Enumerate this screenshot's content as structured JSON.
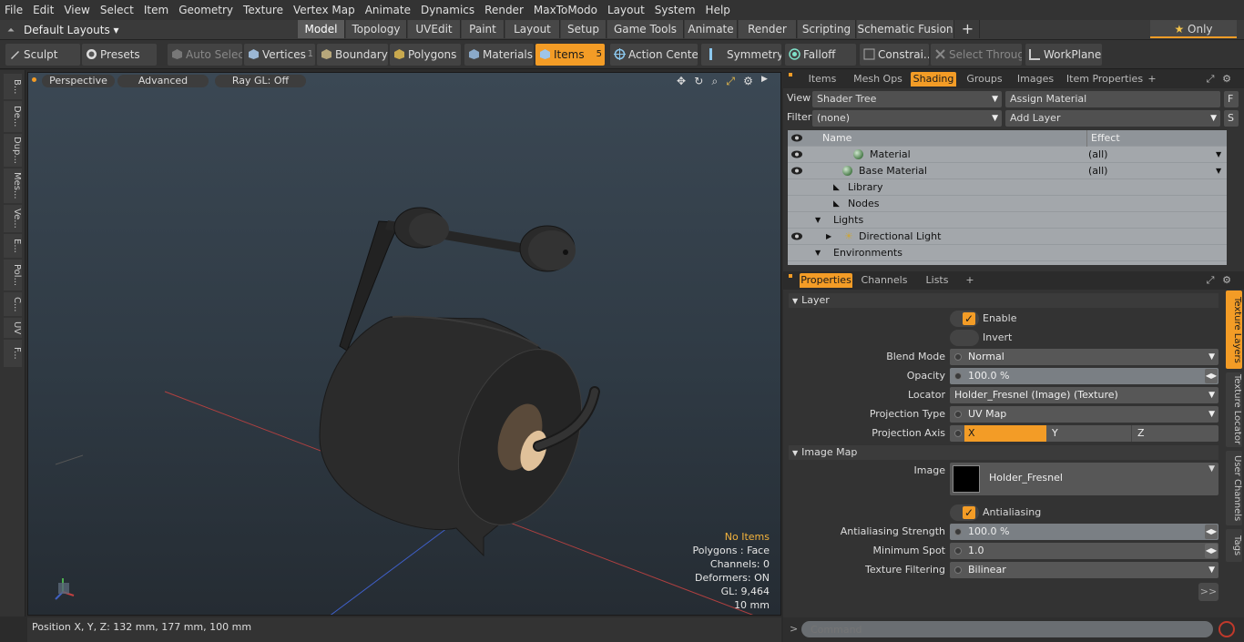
{
  "menu": [
    "File",
    "Edit",
    "View",
    "Select",
    "Item",
    "Geometry",
    "Texture",
    "Vertex Map",
    "Animate",
    "Dynamics",
    "Render",
    "MaxToModo",
    "Layout",
    "System",
    "Help"
  ],
  "layouts_label": "Default Layouts ▾",
  "modes": [
    "Model",
    "Topology",
    "UVEdit",
    "Paint",
    "Layout",
    "Setup",
    "Game Tools",
    "Animate",
    "Render",
    "Scripting",
    "Schematic Fusion"
  ],
  "only_label": "Only",
  "toolbar": {
    "sculpt": "Sculpt",
    "presets": "Presets",
    "auto_select": "Auto Select",
    "vertices": "Vertices",
    "vertices_count": "1",
    "boundary": "Boundary",
    "polygons": "Polygons",
    "materials": "Materials",
    "items": "Items",
    "items_count": "5",
    "action_center": "Action Center",
    "symmetry": "Symmetry",
    "falloff": "Falloff",
    "constrain": "Constrai...",
    "select_through": "Select Through",
    "workplane": "WorkPlane"
  },
  "left_tabs": [
    "B...",
    "De...",
    "Dup...",
    "Mes...",
    "Ve...",
    "E...",
    "Pol...",
    "C...",
    "UV",
    "F..."
  ],
  "viewport": {
    "perspective": "Perspective",
    "advanced": "Advanced",
    "raygl": "Ray GL: Off",
    "no_items": "No Items",
    "polygons": "Polygons : Face",
    "channels": "Channels: 0",
    "deformers": "Deformers: ON",
    "gl": "GL: 9,464",
    "scale": "10 mm"
  },
  "status": "Position X, Y, Z:   132 mm, 177 mm, 100 mm",
  "right_tabs": [
    "Items",
    "Mesh Ops",
    "Shading",
    "Groups",
    "Images",
    "Item Properties"
  ],
  "shader": {
    "view_label": "View",
    "view_value": "Shader Tree",
    "assign": "Assign Material",
    "f_btn": "F",
    "filter_label": "Filter",
    "filter_value": "(none)",
    "add_layer": "Add Layer",
    "s_btn": "S",
    "col_name": "Name",
    "col_effect": "Effect",
    "rows": [
      {
        "name": "Material",
        "effect": "(all)"
      },
      {
        "name": "Base Material",
        "effect": "(all)"
      },
      {
        "name": "Library",
        "effect": ""
      },
      {
        "name": "Nodes",
        "effect": ""
      },
      {
        "name": "Lights",
        "effect": ""
      },
      {
        "name": "Directional Light",
        "effect": ""
      },
      {
        "name": "Environments",
        "effect": ""
      }
    ]
  },
  "prop_tabs": [
    "Properties",
    "Channels",
    "Lists"
  ],
  "props": {
    "layer": "Layer",
    "enable": "Enable",
    "invert": "Invert",
    "blend_label": "Blend Mode",
    "blend": "Normal",
    "opacity_label": "Opacity",
    "opacity": "100.0 %",
    "locator_label": "Locator",
    "locator": "Holder_Fresnel (Image) (Texture)",
    "ptype_label": "Projection Type",
    "ptype": "UV Map",
    "paxis_label": "Projection Axis",
    "ax_x": "X",
    "ax_y": "Y",
    "ax_z": "Z",
    "image_map": "Image Map",
    "image_label": "Image",
    "image": "Holder_Fresnel",
    "antialiasing": "Antialiasing",
    "aa_strength_label": "Antialiasing Strength",
    "aa_strength": "100.0 %",
    "min_spot_label": "Minimum Spot",
    "min_spot": "1.0",
    "filter_label": "Texture Filtering",
    "filter": "Bilinear",
    "more": ">>"
  },
  "side_tabs": [
    "Texture Layers",
    "Texture Locator",
    "User Channels",
    "Tags"
  ],
  "command_placeholder": "Command"
}
